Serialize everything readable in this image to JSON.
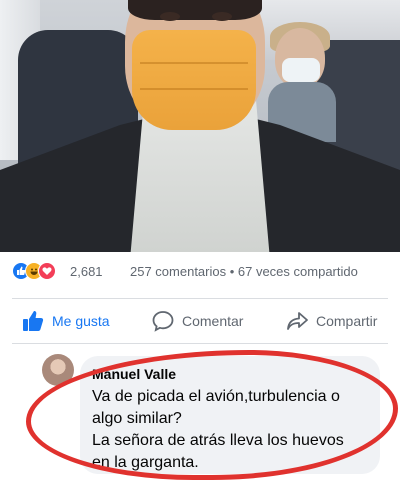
{
  "post": {
    "photo_name": "selfie-in-airplane-photo"
  },
  "reactions": {
    "count": "2,681",
    "meta": "257 comentarios • 67 veces compartido"
  },
  "actions": {
    "like_label": "Me gusta",
    "comment_label": "Comentar",
    "share_label": "Compartir"
  },
  "comment": {
    "author": "Manuel Valle",
    "lines": [
      "Va de picada el avión,turbulencia o",
      "algo similar?",
      "La señora de atrás lleva los huevos",
      "en la garganta."
    ]
  },
  "colors": {
    "accent_blue": "#1877f2",
    "annotation_red": "#e0322e",
    "mask_orange": "#f4b24a"
  }
}
